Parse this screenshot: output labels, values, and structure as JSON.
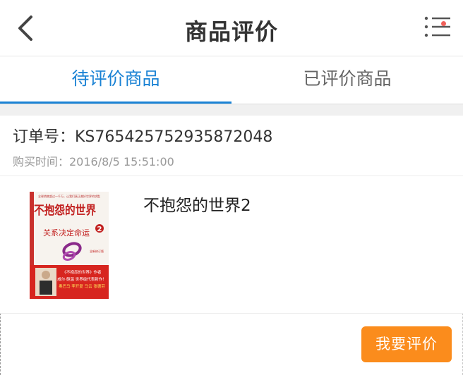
{
  "header": {
    "title": "商品评价",
    "back_icon": "chevron-left-icon",
    "menu_icon": "list-menu-icon",
    "notification_dot_color": "#f0605a"
  },
  "tabs": [
    {
      "label": "待评价商品",
      "active": true
    },
    {
      "label": "已评价商品",
      "active": false
    }
  ],
  "accent_color": "#1a82d4",
  "order": {
    "order_number": "订单号：KS765425752935872048",
    "purchase_time": "购买时间：2016/8/5 15:51:00",
    "items": [
      {
        "name": "不抱怨的世界2",
        "cover": {
          "top_line": "全球销售超过一千万，让我们真正美好世界的钥匙",
          "title": "不抱怨的世界",
          "volume": "2",
          "subtitle": "关系决定命运",
          "sticker": "全新修订版",
          "banner_line1": "《不抱怨的世界》作者",
          "banner_line2": "威尔·鲍温 世界级代表新作！",
          "banner_line3": "奥巴马 李开复 马云 张德芬"
        }
      }
    ]
  },
  "actions": {
    "review_label": "我要评价",
    "review_color": "#fb8c1c"
  }
}
